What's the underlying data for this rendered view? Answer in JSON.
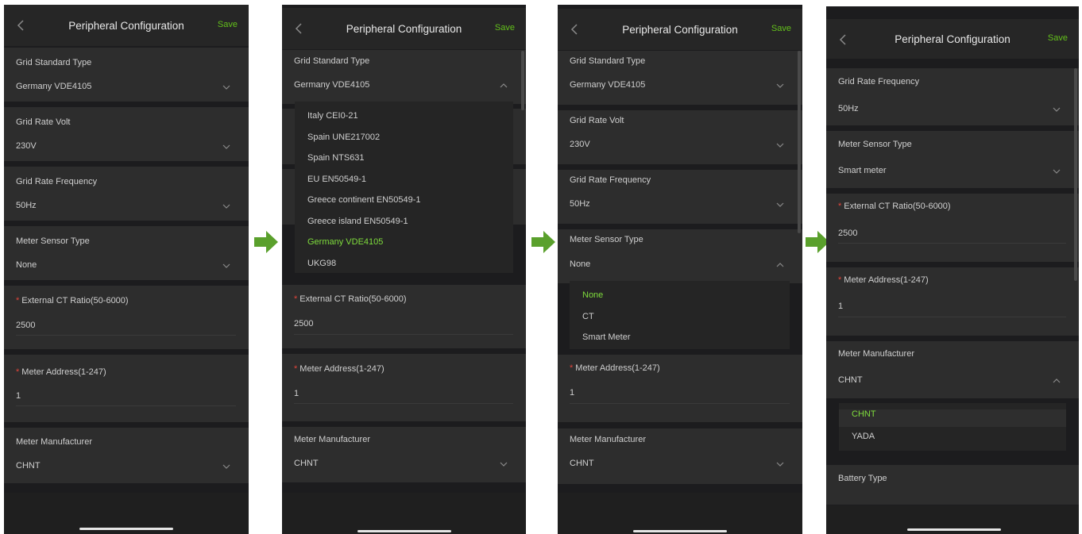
{
  "title": "Peripheral Configuration",
  "save_label": "Save",
  "fields": {
    "grid_standard": {
      "label": "Grid Standard Type",
      "value": "Germany VDE4105"
    },
    "grid_volt": {
      "label": "Grid Rate Volt",
      "value": "230V"
    },
    "grid_freq": {
      "label": "Grid Rate Frequency",
      "value": "50Hz"
    },
    "meter_sensor": {
      "label": "Meter Sensor Type",
      "value": "None",
      "value_smart": "Smart meter"
    },
    "ct_ratio": {
      "label": "External CT Ratio(50-6000)",
      "value": "2500",
      "required": "*"
    },
    "meter_address": {
      "label": "Meter Address(1-247)",
      "value": "1",
      "required": "*"
    },
    "meter_manufacturer": {
      "label": "Meter Manufacturer",
      "value": "CHNT"
    },
    "battery_type": {
      "label": "Battery Type"
    }
  },
  "grid_standard_options": [
    "Italy CEI0-21",
    "Spain UNE217002",
    "Spain NTS631",
    "EU EN50549-1",
    "Greece continent EN50549-1",
    "Greece island EN50549-1",
    "Germany VDE4105",
    "UKG98"
  ],
  "meter_sensor_options": [
    "None",
    "CT",
    "Smart Meter"
  ],
  "manufacturer_options": [
    "CHNT",
    "YADA"
  ],
  "colors": {
    "accent": "#63c01b",
    "selected": "#7fdd3c",
    "required": "#e0453b",
    "arrow": "#5aa02c",
    "background": "#1c1c1e"
  }
}
